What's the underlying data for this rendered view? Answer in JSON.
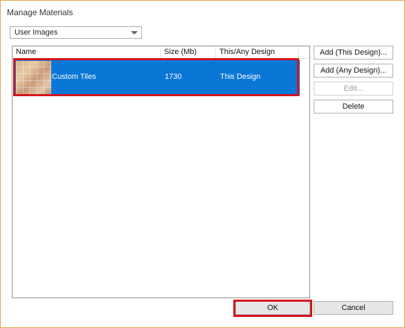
{
  "dialog": {
    "title": "Manage Materials"
  },
  "filter": {
    "selected": "User Images"
  },
  "list": {
    "columns": [
      "Name",
      "Size (Mb)",
      "This/Any Design"
    ],
    "rows": [
      {
        "name": "Custom Tiles",
        "size": "1730",
        "scope": "This Design",
        "thumbnail": "tile-pattern-thumbnail"
      }
    ]
  },
  "actions": {
    "add_this": "Add (This Design)...",
    "add_any": "Add (Any Design)...",
    "edit": "Edit...",
    "delete": "Delete"
  },
  "footer": {
    "ok": "OK",
    "cancel": "Cancel"
  },
  "colors": {
    "selection": "#0a77d6",
    "highlight": "#d4141c",
    "window_border": "#e7a24a"
  }
}
